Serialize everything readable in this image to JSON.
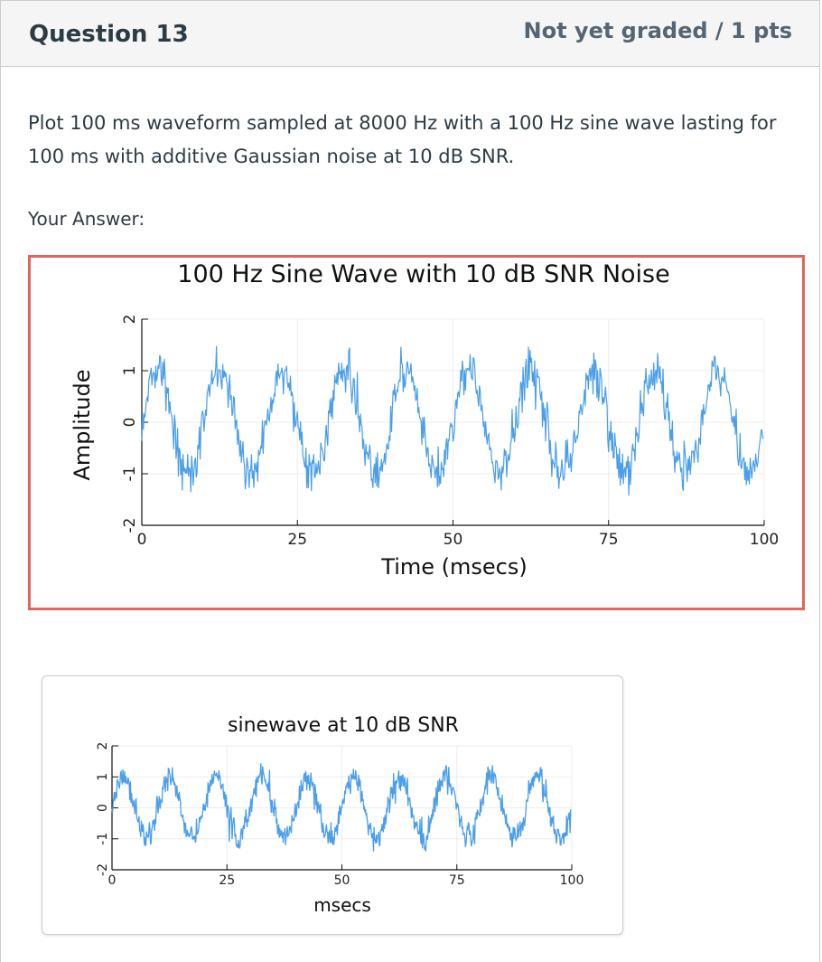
{
  "question": {
    "title": "Question 13",
    "score": "Not yet graded / 1 pts",
    "text": "Plot 100 ms waveform sampled at 8000 Hz with a 100 Hz sine wave lasting for 100 ms with additive Gaussian noise at 10 dB SNR.",
    "answer_label": "Your Answer:"
  },
  "colors": {
    "accent_border": "#e0655e",
    "line": "#4a9eea"
  },
  "chart_data": [
    {
      "type": "line",
      "title": "100 Hz Sine Wave with 10 dB SNR Noise",
      "xlabel": "Time (msecs)",
      "ylabel": "Amplitude",
      "xlim": [
        0,
        100
      ],
      "ylim": [
        -2,
        2
      ],
      "xticks": [
        "0",
        "25",
        "50",
        "75",
        "100"
      ],
      "yticks": [
        "2",
        "1",
        "0",
        "-1",
        "-2"
      ],
      "grid": true,
      "series": [
        {
          "frequency_hz": 100,
          "amplitude": 1,
          "snr_db": 10,
          "duration_ms": 100,
          "sample_rate_hz": 8000
        }
      ]
    },
    {
      "type": "line",
      "title": "sinewave at 10 dB SNR",
      "xlabel": "msecs",
      "ylabel": "",
      "xlim": [
        0,
        100
      ],
      "ylim": [
        -2,
        2
      ],
      "xticks": [
        "0",
        "25",
        "50",
        "75",
        "100"
      ],
      "yticks": [
        "2",
        "1",
        "0",
        "-1",
        "-2"
      ],
      "grid": true,
      "series": [
        {
          "frequency_hz": 100,
          "amplitude": 1,
          "snr_db": 10,
          "duration_ms": 100,
          "sample_rate_hz": 8000
        }
      ]
    }
  ]
}
